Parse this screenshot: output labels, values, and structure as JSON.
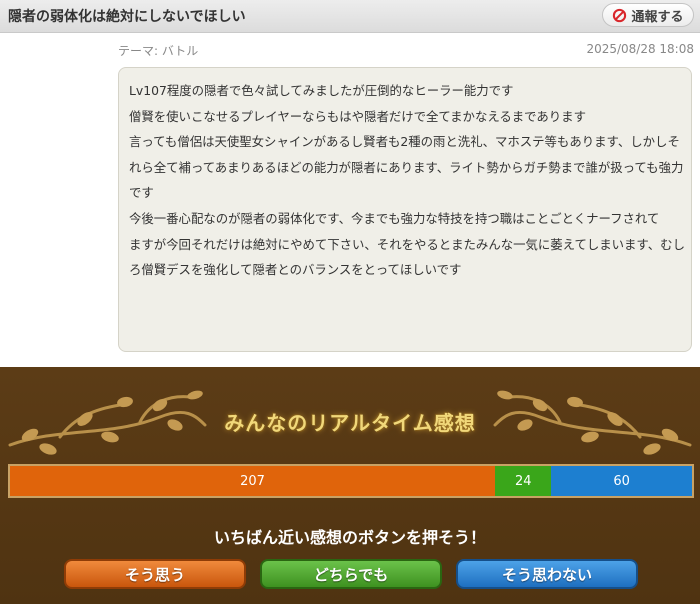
{
  "header": {
    "title": "隠者の弱体化は絶対にしないでほしい",
    "report_label": "通報する"
  },
  "post": {
    "theme": "テーマ: バトル",
    "timestamp": "2025/08/28 18:08",
    "lines": [
      "Lv107程度の隠者で色々試してみましたが圧倒的なヒーラー能力です",
      "僧賢を使いこなせるプレイヤーならもはや隠者だけで全てまかなえるまであります",
      "言っても僧侶は天使聖女シャインがあるし賢者も2種の雨と洗礼、マホステ等もあります、しかしそ",
      "れら全て補ってあまりあるほどの能力が隠者にあります、ライト勢からガチ勢まで誰が扱っても強力",
      "です",
      "今後一番心配なのが隠者の弱体化です、今までも強力な特技を持つ職はことごとくナーフされて",
      "ますが今回それだけは絶対にやめて下さい、それをやるとまたみんな一気に萎えてしまいます、むし",
      "ろ僧賢デスを強化して隠者とのバランスをとってほしいです"
    ]
  },
  "realtime": {
    "title": "みんなのリアルタイム感想",
    "results": {
      "agree": 207,
      "either": 24,
      "disagree": 60
    },
    "prompt": "いちばん近い感想のボタンを押そう！",
    "buttons": {
      "agree": "そう思う",
      "either": "どちらでも",
      "disagree": "そう思わない"
    }
  },
  "colors": {
    "agree": "#e0640b",
    "either": "#3aa61a",
    "disagree": "#1d7fd0",
    "panel_bg": "#5c3c16",
    "title_gold": "#f1d87a"
  },
  "icons": {
    "report": "prohibit-icon",
    "decoration": "vine-ornament-icon"
  }
}
